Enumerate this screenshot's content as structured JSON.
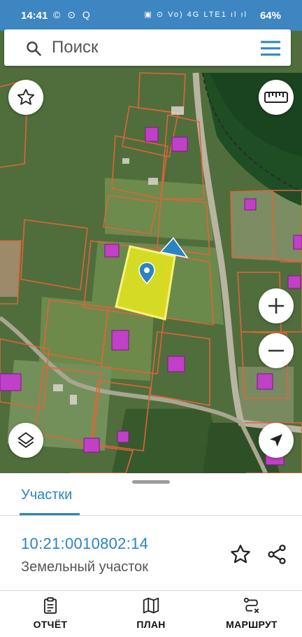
{
  "status_bar": {
    "time": "14:41",
    "left_icons": "© ⊙ Q",
    "right_icons": "▣ ⊙ Vo) 4G LTE1 ıl ıl",
    "battery": "64%"
  },
  "search": {
    "placeholder": "Поиск"
  },
  "icons": {
    "search": "search-icon",
    "menu": "hamburger-menu-icon",
    "favorite": "star-icon",
    "ruler": "ruler-icon",
    "zoom_in": "plus-icon",
    "zoom_out": "minus-icon",
    "layers": "layers-icon",
    "location": "navigation-arrow-icon",
    "marker": "map-pin-icon",
    "share": "share-icon",
    "report": "clipboard-icon",
    "plan": "map-icon",
    "route": "route-icon"
  },
  "colors": {
    "accent": "#2a84c1",
    "status_bar": "#3d86c2",
    "selected_parcel": "#e8e81e",
    "parcel_border": "#e0643a",
    "building": "#c040c8"
  },
  "sheet": {
    "tab_label": "Участки",
    "parcel_id": "10:21:0010802:14",
    "parcel_type": "Земельный участок"
  },
  "bottom_nav": {
    "report": "ОТЧЁТ",
    "plan": "ПЛАН",
    "route": "МАРШРУТ"
  }
}
